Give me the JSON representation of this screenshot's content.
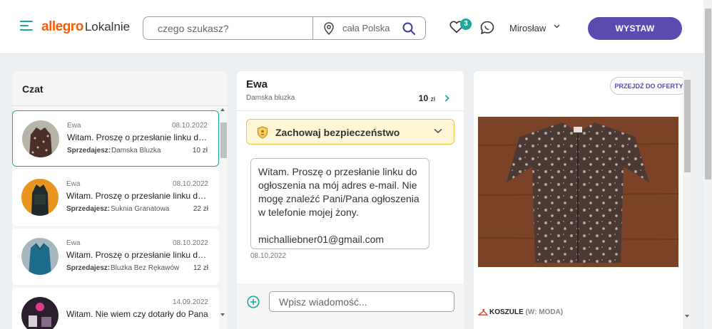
{
  "header": {
    "logo_brand": "allegro",
    "logo_sub": "Lokalnie",
    "search_placeholder": "czego szukasz?",
    "location": "cała Polska",
    "favorites_count": "3",
    "username": "Mirosław",
    "publish_label": "WYSTAW"
  },
  "chat_list": {
    "title": "Czat",
    "seller_label": "Sprzedajesz:",
    "items": [
      {
        "name": "Ewa",
        "date": "08.10.2022",
        "message": "Witam. Proszę o przesłanie linku do ogłoszenia",
        "product": "Damska Bluzka",
        "price": "10 zł",
        "active": true
      },
      {
        "name": "Ewa",
        "date": "08.10.2022",
        "message": "Witam. Proszę o przesłanie linku do ogłoszenia",
        "product": "Suknia Granatowa",
        "price": "22 zł",
        "active": false
      },
      {
        "name": "Ewa",
        "date": "08.10.2022",
        "message": "Witam. Proszę o przesłanie linku do ogłoszenia",
        "product": "Bluzka Bez Rękawów",
        "price": "12 zł",
        "active": false
      },
      {
        "name": "",
        "date": "14.09.2022",
        "message": "Witam. Nie wiem czy dotarły do Pana",
        "product": "",
        "price": "",
        "active": false
      }
    ]
  },
  "conversation": {
    "name": "Ewa",
    "product": "Damska bluzka",
    "price_value": "10",
    "price_currency": "zł",
    "safety_label": "Zachowaj bezpieczeństwo",
    "message_text": "Witam. Proszę o przesłanie linku do ogłoszenia na mój adres e-mail. Nie mogę znaleźć Pani/Pana ogłoszenia w telefonie mojej żony.",
    "message_email": "michalliebner01@gmail.com",
    "message_date": "08.10.2022",
    "compose_placeholder": "Wpisz wiadomość..."
  },
  "offer": {
    "go_to_offer_label": "PRZEJDŹ DO OFERTY",
    "category_main": "KOSZULE",
    "category_sub": "(W: MODA)"
  },
  "colors": {
    "accent": "#1aaa9b",
    "brand": "#ff5a00",
    "primary_button": "#5a4bb0",
    "safety_bg": "#fff6d6",
    "safety_border": "#f0c34c"
  },
  "icons": [
    "hamburger-icon",
    "location-pin-icon",
    "search-icon",
    "heart-icon",
    "chat-bubble-icon",
    "chevron-down-icon",
    "chevron-right-icon",
    "shield-icon",
    "plus-circle-icon",
    "hanger-icon"
  ]
}
